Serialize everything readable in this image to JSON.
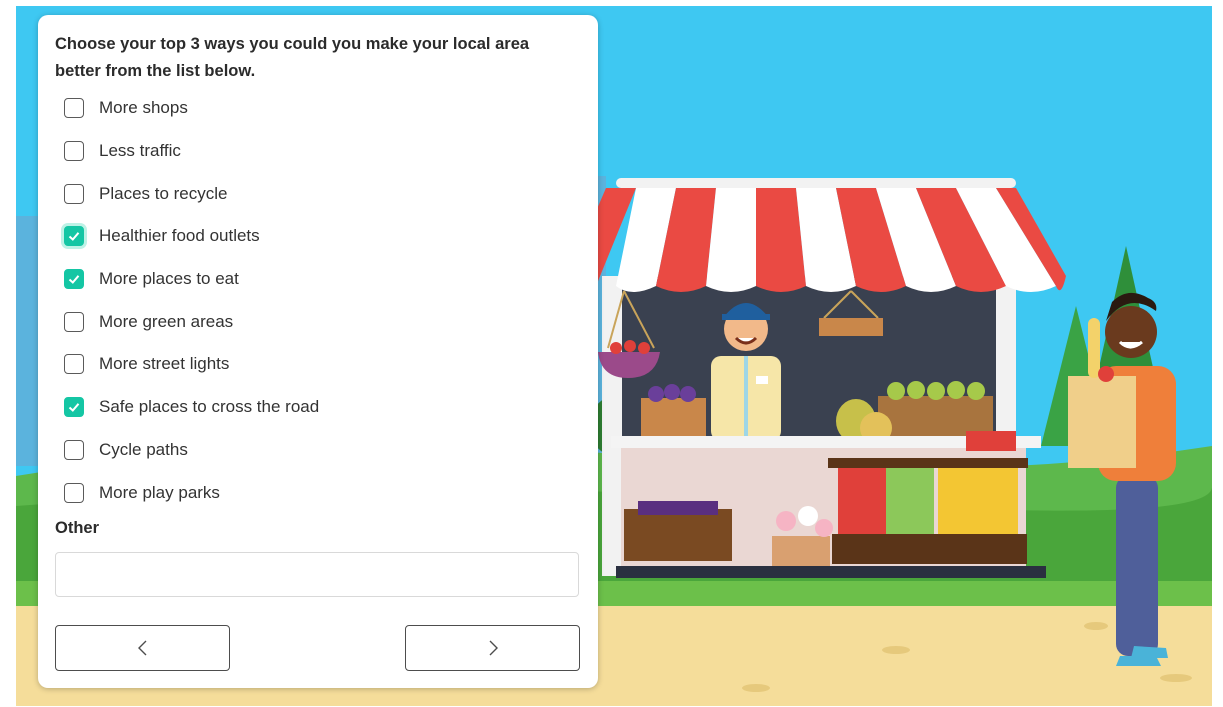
{
  "survey": {
    "question": "Choose your top 3 ways you could you make your local area better from the list below.",
    "options": [
      {
        "label": "More shops",
        "checked": false
      },
      {
        "label": "Less traffic",
        "checked": false
      },
      {
        "label": "Places to recycle",
        "checked": false
      },
      {
        "label": "Healthier food outlets",
        "checked": true,
        "focused": true
      },
      {
        "label": "More places to eat",
        "checked": true
      },
      {
        "label": "More green areas",
        "checked": false
      },
      {
        "label": "More street lights",
        "checked": false
      },
      {
        "label": "Safe places to cross the road",
        "checked": true
      },
      {
        "label": "Cycle paths",
        "checked": false
      },
      {
        "label": "More play parks",
        "checked": false
      }
    ],
    "other_label": "Other",
    "other_value": "",
    "other_placeholder": ""
  },
  "nav": {
    "back_icon": "chevron-left-icon",
    "next_icon": "chevron-right-icon"
  },
  "colors": {
    "accent": "#14c6a4",
    "sky": "#3ec8f2",
    "ground": "#f5dd9a",
    "awning_red": "#ea4a43"
  }
}
